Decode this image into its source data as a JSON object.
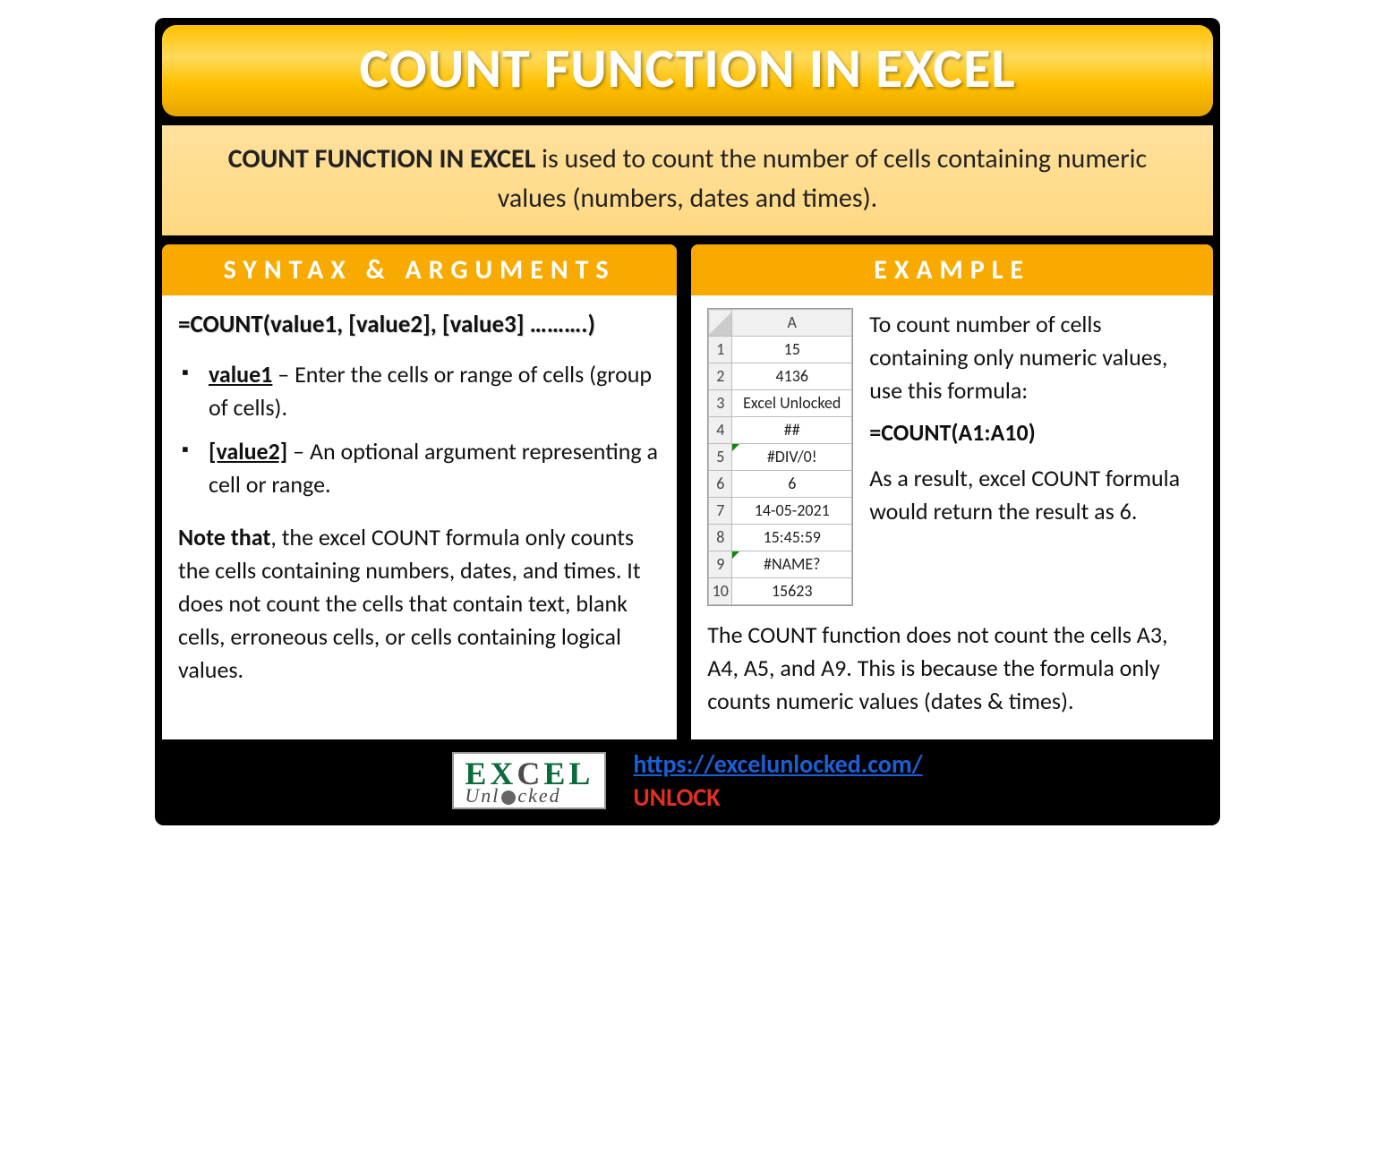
{
  "title": "COUNT FUNCTION IN EXCEL",
  "description": {
    "bold": "COUNT FUNCTION IN EXCEL",
    "rest": " is used to count the number of cells containing numeric values (numbers, dates and times)."
  },
  "syntax": {
    "heading": "SYNTAX & ARGUMENTS",
    "formula": "=COUNT(value1, [value2], [value3] ……….)",
    "args": [
      {
        "name": "value1",
        "desc": " – Enter the cells or range of cells (group of cells)."
      },
      {
        "name": "[value2]",
        "desc": " – An optional argument representing a cell or range."
      }
    ],
    "note_bold": "Note that",
    "note_rest": ", the excel COUNT formula only counts the cells containing numbers, dates, and times. It does not count the cells that contain text, blank cells, erroneous cells, or cells containing logical values."
  },
  "example": {
    "heading": "EXAMPLE",
    "col_header": "A",
    "rows": [
      {
        "n": "1",
        "v": "15",
        "err": false
      },
      {
        "n": "2",
        "v": "4136",
        "err": false
      },
      {
        "n": "3",
        "v": "Excel Unlocked",
        "err": false
      },
      {
        "n": "4",
        "v": "##",
        "err": false
      },
      {
        "n": "5",
        "v": "#DIV/0!",
        "err": true
      },
      {
        "n": "6",
        "v": "6",
        "err": false
      },
      {
        "n": "7",
        "v": "14-05-2021",
        "err": false
      },
      {
        "n": "8",
        "v": "15:45:59",
        "err": false
      },
      {
        "n": "9",
        "v": "#NAME?",
        "err": true
      },
      {
        "n": "10",
        "v": "15623",
        "err": false
      }
    ],
    "intro": "To count number of cells containing only numeric values, use this formula:",
    "formula": "=COUNT(A1:A10)",
    "result_text": "As a result, excel COUNT formula would return the result as 6.",
    "explain": "The COUNT function does not count the cells A3, A4, A5, and A9. This is because the formula only counts numeric values (dates & times)."
  },
  "footer": {
    "logo_line1a": "EX",
    "logo_line1c": "C",
    "logo_line1b": "EL",
    "logo_line2a": "Unl",
    "logo_line2b": "cked",
    "url": "https://excelunlocked.com/",
    "tagline": "UNLOCK"
  }
}
